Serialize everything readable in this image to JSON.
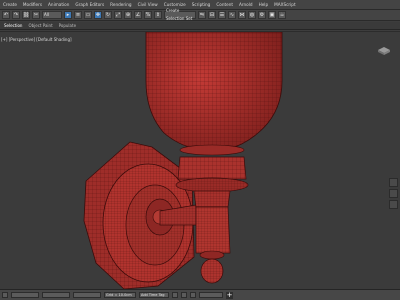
{
  "menu": {
    "items": [
      "Create",
      "Modifiers",
      "Animation",
      "Graph Editors",
      "Rendering",
      "Civil View",
      "Customize",
      "Scripting",
      "Content",
      "Arnold",
      "Help",
      "MAXScript"
    ]
  },
  "toolbar": {
    "selection_filter": "All",
    "named_selection": "Create Selection Set"
  },
  "ribbon": {
    "tabs": [
      "Selection",
      "Object Paint",
      "Populate"
    ]
  },
  "viewport": {
    "label": "[+] [Perspective] [Default Shading]"
  },
  "statusbar": {
    "grid": "Grid = 10.0cm",
    "add_time_tag": "Add Time Tag",
    "fields": [
      "",
      "",
      "",
      ""
    ]
  },
  "colors": {
    "model": "#a4302c",
    "wire": "#4a0f0e",
    "accent": "#3c78b5",
    "background": "#3b3b3b"
  }
}
